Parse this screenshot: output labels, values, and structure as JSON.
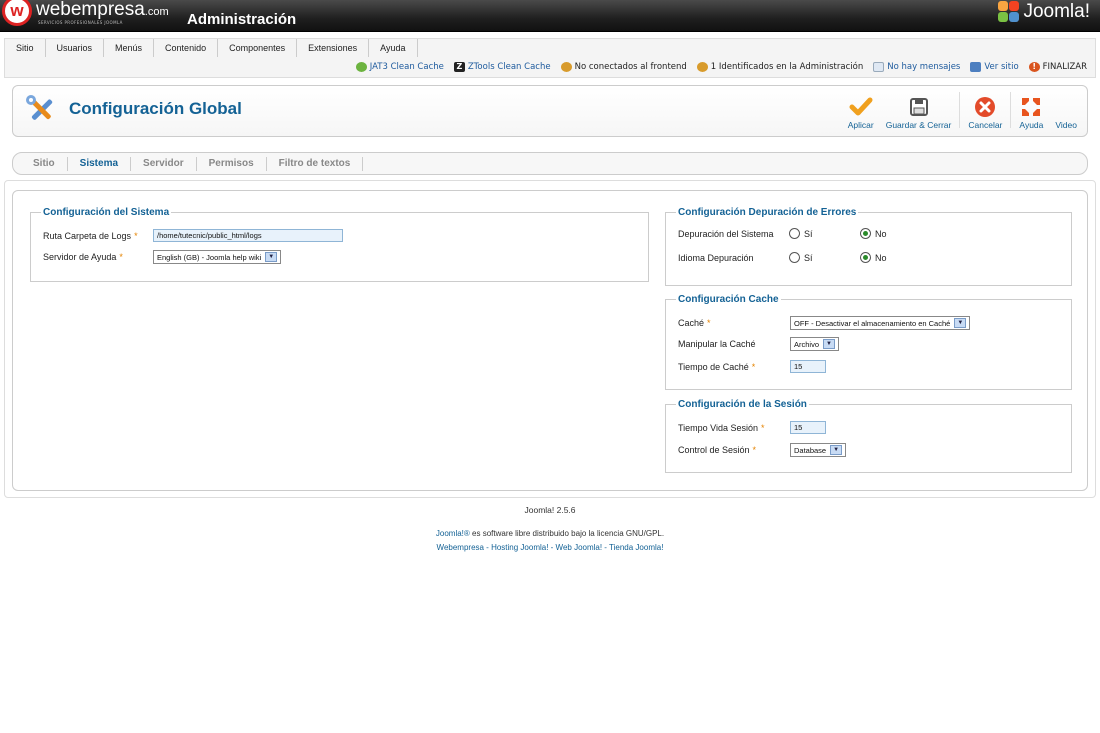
{
  "header": {
    "brand_main": "webempresa",
    "brand_suffix": ".com",
    "brand_tagline": "SERVICIOS PROFESIONALES JOOMLA",
    "title": "Administración",
    "joomla_logo_text": "Joomla!"
  },
  "menu": {
    "items": [
      {
        "label": "Sitio"
      },
      {
        "label": "Usuarios"
      },
      {
        "label": "Menús"
      },
      {
        "label": "Contenido"
      },
      {
        "label": "Componentes"
      },
      {
        "label": "Extensiones"
      },
      {
        "label": "Ayuda"
      }
    ]
  },
  "status": {
    "jat3_cache": "JAT3 Clean Cache",
    "ztools_cache": "ZTools Clean Cache",
    "frontend": "No conectados al frontend",
    "admins": "1 Identificados en la Administración",
    "messages": "No hay mensajes",
    "view_site": "Ver sitio",
    "logout": "FINALIZAR"
  },
  "toolbar": {
    "title": "Configuración Global",
    "buttons": {
      "apply": "Aplicar",
      "save_close": "Guardar & Cerrar",
      "cancel": "Cancelar",
      "help": "Ayuda",
      "video": "Video"
    }
  },
  "tabs": [
    {
      "label": "Sitio",
      "active": false
    },
    {
      "label": "Sistema",
      "active": true
    },
    {
      "label": "Servidor",
      "active": false
    },
    {
      "label": "Permisos",
      "active": false
    },
    {
      "label": "Filtro de textos",
      "active": false
    }
  ],
  "system": {
    "legend": "Configuración del Sistema",
    "logs_label": "Ruta Carpeta de Logs",
    "logs_value": "/home/tutecnic/public_html/logs",
    "help_label": "Servidor de Ayuda",
    "help_value": "English (GB) - Joomla help wiki"
  },
  "debug": {
    "legend": "Configuración Depuración de Errores",
    "system_label": "Depuración del Sistema",
    "lang_label": "Idioma Depuración",
    "yes": "Sí",
    "no": "No",
    "system_value": "No",
    "lang_value": "No"
  },
  "cache": {
    "legend": "Configuración Cache",
    "cache_label": "Caché",
    "cache_value": "OFF - Desactivar el almacenamiento en Caché",
    "handler_label": "Manipular la Caché",
    "handler_value": "Archivo",
    "time_label": "Tiempo de Caché",
    "time_value": "15"
  },
  "session": {
    "legend": "Configuración de la Sesión",
    "lifetime_label": "Tiempo Vida Sesión",
    "lifetime_value": "15",
    "handler_label": "Control de Sesión",
    "handler_value": "Database"
  },
  "footer": {
    "version": "Joomla! 2.5.6",
    "license_brand": "Joomla!®",
    "license_text": " es software libre distribuido bajo la licencia GNU/GPL.",
    "links": "Webempresa - Hosting Joomla! - Web Joomla! - Tienda Joomla!"
  },
  "colors": {
    "accent": "#146295",
    "required": "#e58300",
    "header_bg": "#1f1f1f"
  }
}
